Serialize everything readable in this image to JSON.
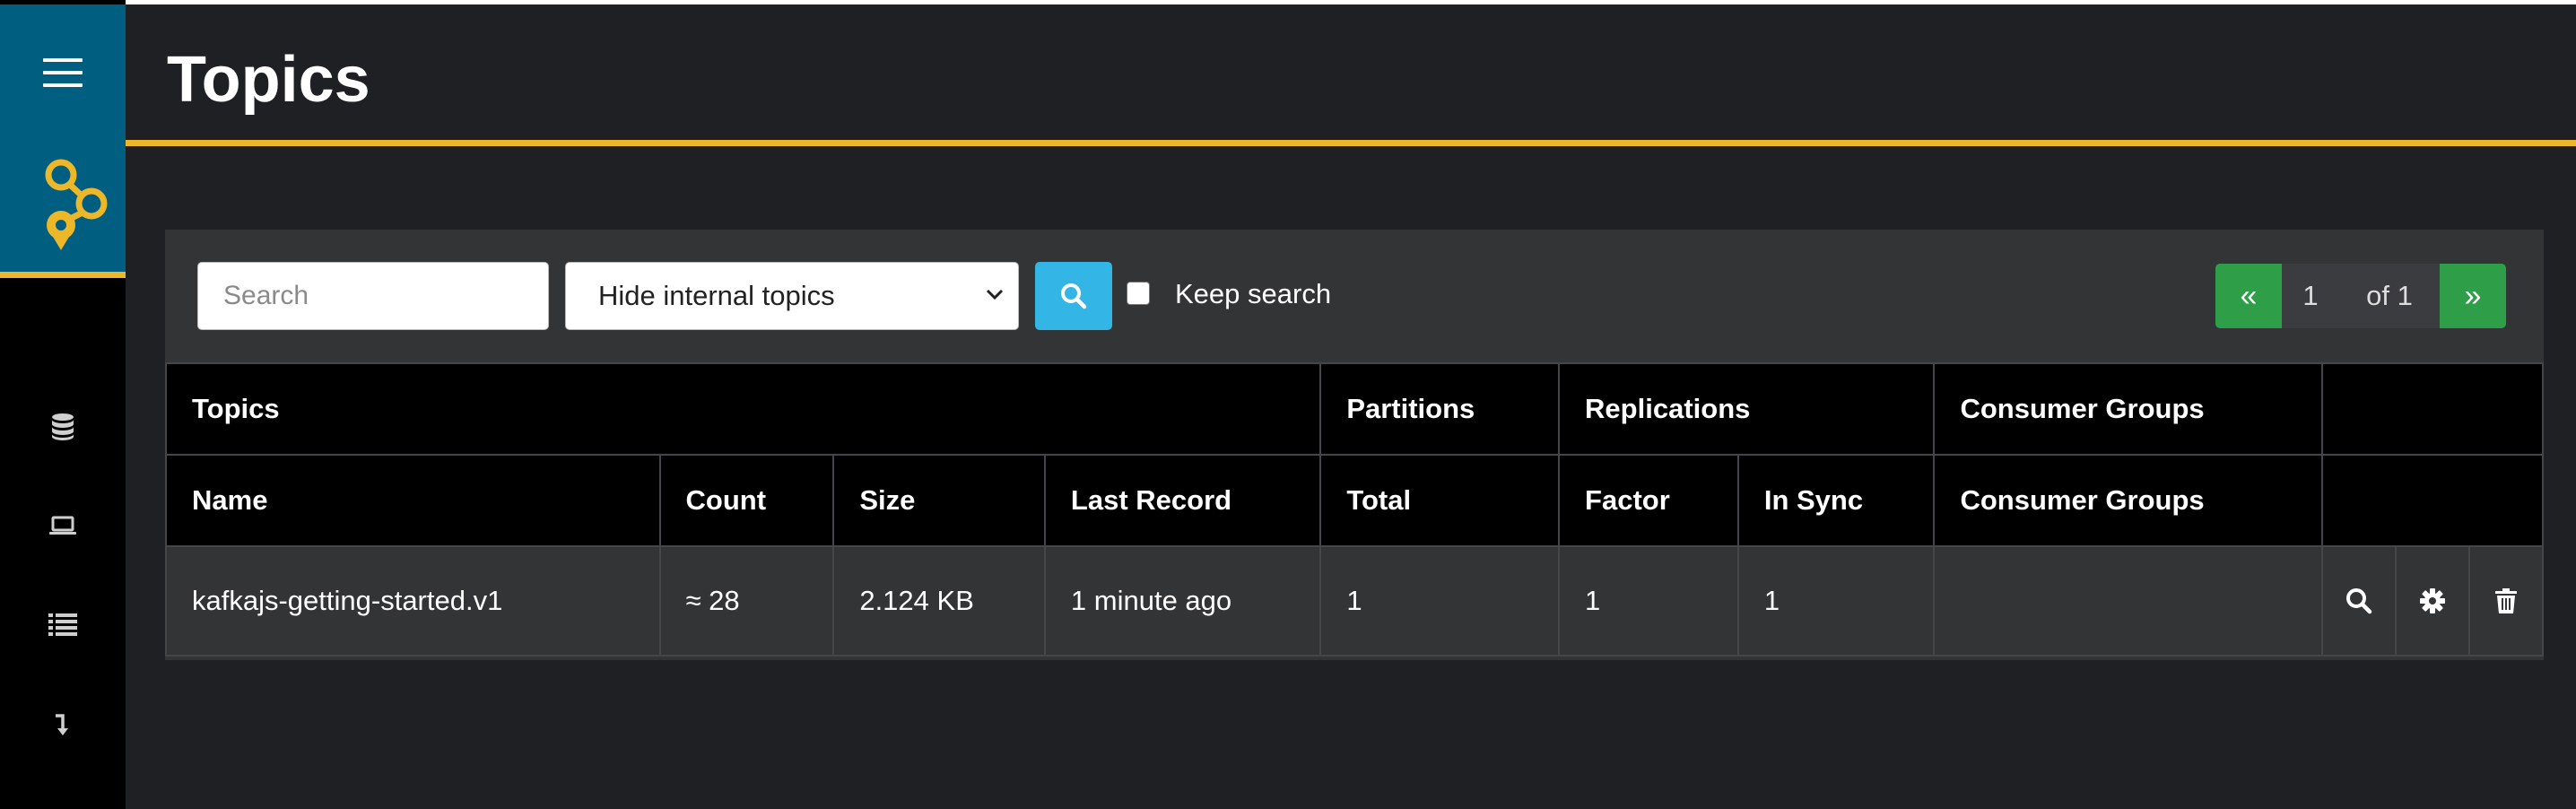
{
  "sidebar": {
    "menu_icon": "hamburger-menu-icon",
    "logo_icon": "kafka-hq-logo-icon",
    "items": [
      {
        "icon": "database-icon"
      },
      {
        "icon": "laptop-icon"
      },
      {
        "icon": "list-icon"
      },
      {
        "icon": "arrow-return-icon"
      }
    ]
  },
  "header": {
    "title": "Topics"
  },
  "toolbar": {
    "search_placeholder": "Search",
    "search_value": "",
    "filter_selected": "Hide internal topics",
    "search_button_icon": "search-icon",
    "keep_search_label": "Keep search",
    "keep_search_checked": false
  },
  "pagination": {
    "prev_label": "«",
    "current_page": "1",
    "of_label": "of 1",
    "next_label": "»"
  },
  "table": {
    "group_headers": {
      "topics": "Topics",
      "partitions": "Partitions",
      "replications": "Replications",
      "consumer_groups": "Consumer Groups"
    },
    "columns": {
      "name": "Name",
      "count": "Count",
      "size": "Size",
      "last_record": "Last Record",
      "total": "Total",
      "factor": "Factor",
      "in_sync": "In Sync",
      "consumer_groups": "Consumer Groups"
    },
    "rows": [
      {
        "name": "kafkajs-getting-started.v1",
        "count": "≈ 28",
        "size": "2.124 KB",
        "last_record": "1 minute ago",
        "total": "1",
        "factor": "1",
        "in_sync": "1",
        "consumer_groups": ""
      }
    ]
  },
  "colors": {
    "accent_yellow": "#ecb729",
    "sidebar_top_blue": "#005f81",
    "search_button_blue": "#33b5e5",
    "pager_green": "#2e9f48",
    "background": "#1f2023"
  }
}
